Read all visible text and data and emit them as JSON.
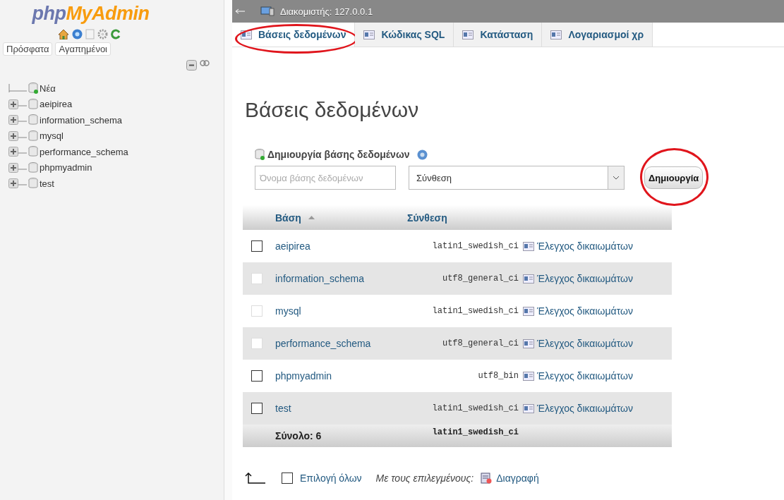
{
  "sidebar": {
    "logo": {
      "prefix": "php",
      "name": "MyAdmin"
    },
    "tabs": [
      {
        "label": "Πρόσφατα"
      },
      {
        "label": "Αγαπημένοι"
      }
    ],
    "tree": [
      {
        "kind": "new",
        "label": "Νέα"
      },
      {
        "kind": "database",
        "label": "aeipirea"
      },
      {
        "kind": "database",
        "label": "information_schema"
      },
      {
        "kind": "database",
        "label": "mysql"
      },
      {
        "kind": "database",
        "label": "performance_schema"
      },
      {
        "kind": "database",
        "label": "phpmyadmin"
      },
      {
        "kind": "database",
        "label": "test"
      }
    ]
  },
  "breadcrumb": {
    "server": "Διακομιστής: 127.0.0.1"
  },
  "tabs": [
    {
      "label": "Βάσεις δεδομένων",
      "selected": true,
      "highlighted": true
    },
    {
      "label": "Κώδικας SQL",
      "selected": false,
      "highlighted": false
    },
    {
      "label": "Κατάσταση",
      "selected": false,
      "highlighted": false
    },
    {
      "label": "Λογαριασμοί χρ",
      "selected": false,
      "highlighted": false
    }
  ],
  "heading": "Βάσεις δεδομένων",
  "create": {
    "title": "Δημιουργία βάσης δεδομένων",
    "name_placeholder": "Όνομα βάσης δεδομένων",
    "collation": "Σύνθεση",
    "button": "Δημιουργία",
    "highlighted": true
  },
  "table": {
    "columns": [
      "Βάση",
      "Σύνθεση"
    ],
    "rows": [
      {
        "name": "aeipirea",
        "collation": "latin1_swedish_ci",
        "action": "Έλεγχος δικαιωμάτων",
        "disabled": false
      },
      {
        "name": "information_schema",
        "collation": "utf8_general_ci",
        "action": "Έλεγχος δικαιωμάτων",
        "disabled": true
      },
      {
        "name": "mysql",
        "collation": "latin1_swedish_ci",
        "action": "Έλεγχος δικαιωμάτων",
        "disabled": true
      },
      {
        "name": "performance_schema",
        "collation": "utf8_general_ci",
        "action": "Έλεγχος δικαιωμάτων",
        "disabled": true
      },
      {
        "name": "phpmyadmin",
        "collation": "utf8_bin",
        "action": "Έλεγχος δικαιωμάτων",
        "disabled": false
      },
      {
        "name": "test",
        "collation": "latin1_swedish_ci",
        "action": "Έλεγχος δικαιωμάτων",
        "disabled": false
      }
    ],
    "total": {
      "label": "Σύνολο: 6",
      "collation": "latin1_swedish_ci"
    }
  },
  "footer": {
    "select_all_checked": false,
    "select_all": "Επιλογή όλων",
    "with_selected": "Με τους επιλεγμένους:",
    "delete": "Διαγραφή"
  }
}
